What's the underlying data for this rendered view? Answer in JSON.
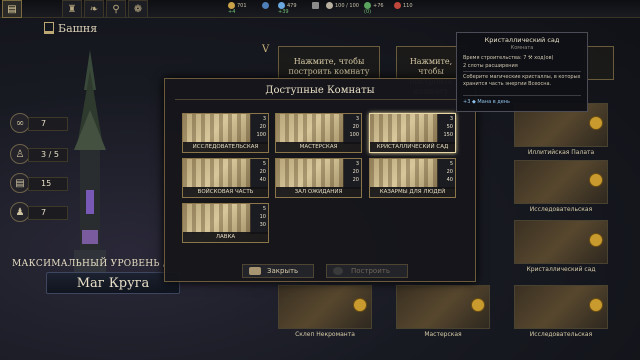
{
  "topbar": {
    "resources": [
      {
        "icon": "gold-icon",
        "value": "701",
        "delta": "+4"
      },
      {
        "icon": "mana-crystal-icon",
        "value": "479",
        "delta": "+39"
      },
      {
        "icon": "people-icon",
        "value": "100 / 100",
        "delta": ""
      },
      {
        "icon": "herb-icon",
        "value": "+76",
        "delta": "(0)"
      },
      {
        "icon": "heart-icon",
        "value": "110",
        "delta": ""
      }
    ],
    "tabs": [
      "book-icon",
      "tower-icon",
      "bird-icon",
      "chalice-icon",
      "leaf-icon"
    ],
    "extra_icons": [
      "water-icon",
      "hammer-icon",
      "gear-icon"
    ]
  },
  "tower": {
    "label": "Башня",
    "stats": [
      {
        "icon": "rings-icon",
        "value": "7"
      },
      {
        "icon": "people-icon",
        "value": "3 / 5"
      },
      {
        "icon": "scroll-icon",
        "value": "15"
      },
      {
        "icon": "person-icon",
        "value": "7"
      }
    ],
    "max_level": "МАКСИМАЛЬНЫЙ УРОВЕНЬ /",
    "rank": "Маг Круга"
  },
  "background": {
    "floor_marker": "V",
    "build_prompt": "Нажмите, чтобы построить комнату",
    "rooms": [
      "Иллитийская Палата",
      "Исследовательская",
      "Кристаллический сад",
      "Склеп Некроманта",
      "Мастерская",
      "Исследовательская"
    ]
  },
  "modal": {
    "title": "Доступные Комнаты",
    "cards": [
      {
        "name": "Исследовательская",
        "nums": [
          "3",
          "20",
          "100"
        ]
      },
      {
        "name": "Мастерская",
        "nums": [
          "3",
          "20",
          "100"
        ]
      },
      {
        "name": "Кристаллический сад",
        "nums": [
          "3",
          "50",
          "150"
        ]
      },
      {
        "name": "Войсковая часть",
        "nums": [
          "5",
          "20",
          "40"
        ]
      },
      {
        "name": "Зал ожидания",
        "nums": [
          "3",
          "20",
          "20"
        ]
      },
      {
        "name": "Казармы для людей",
        "nums": [
          "5",
          "20",
          "40"
        ]
      },
      {
        "name": "Лавка",
        "nums": [
          "5",
          "10",
          "30"
        ]
      }
    ],
    "close_label": "Закрыть",
    "build_label": "Построить"
  },
  "tooltip": {
    "title": "Кристаллический сад",
    "subtitle": "Комната",
    "build_time": "Время строительства: 7",
    "build_time_unit": "ход(ов)",
    "slots": "2 слоты расширения",
    "description": "Соберите магические кристаллы, в которых хранится часть энергии Всеоснa.",
    "effect_value": "+3",
    "effect_text": "Мана в день"
  },
  "colors": {
    "accent_gold": "#c9a24a",
    "mana_blue": "#6aa8e0",
    "delta_green": "#6fbf73"
  }
}
